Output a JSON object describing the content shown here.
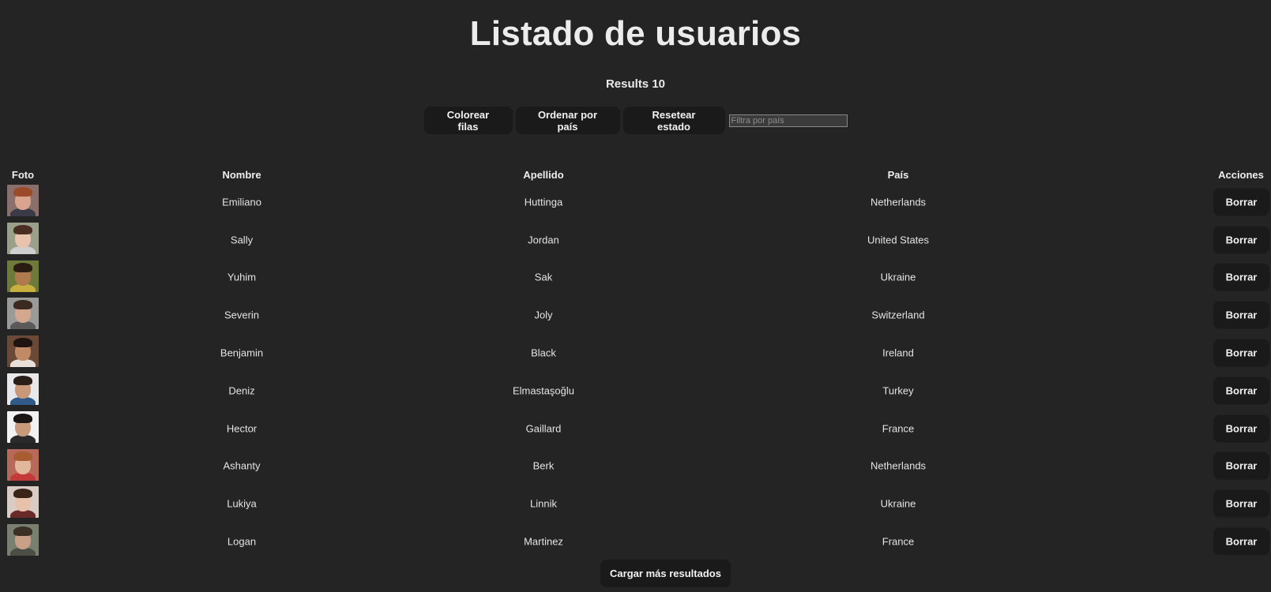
{
  "page": {
    "title": "Listado de usuarios",
    "results_label": "Results 10"
  },
  "controls": {
    "color_rows_label": "Colorear filas",
    "sort_country_label": "Ordenar por país",
    "reset_label": "Resetear estado",
    "filter_placeholder": "Filtra por país",
    "filter_value": ""
  },
  "table": {
    "headers": {
      "photo": "Foto",
      "first_name": "Nombre",
      "last_name": "Apellido",
      "country": "País",
      "actions": "Acciones"
    },
    "delete_label": "Borrar",
    "rows": [
      {
        "first_name": "Emiliano",
        "last_name": "Huttinga",
        "country": "Netherlands",
        "photo": {
          "bg": "#8a6f6a",
          "skin": "#d9a48e",
          "hair": "#9b4a2c",
          "shirt": "#3a3a48"
        }
      },
      {
        "first_name": "Sally",
        "last_name": "Jordan",
        "country": "United States",
        "photo": {
          "bg": "#9aa08a",
          "skin": "#e8c4ae",
          "hair": "#4a2e22",
          "shirt": "#cfcfcf"
        }
      },
      {
        "first_name": "Yuhim",
        "last_name": "Sak",
        "country": "Ukraine",
        "photo": {
          "bg": "#6e7a3a",
          "skin": "#b07a4e",
          "hair": "#2a1c12",
          "shirt": "#c8b040"
        }
      },
      {
        "first_name": "Severin",
        "last_name": "Joly",
        "country": "Switzerland",
        "photo": {
          "bg": "#9a9a98",
          "skin": "#d4a88e",
          "hair": "#3a2a20",
          "shirt": "#5a5a5a"
        }
      },
      {
        "first_name": "Benjamin",
        "last_name": "Black",
        "country": "Ireland",
        "photo": {
          "bg": "#6a4a36",
          "skin": "#c08a66",
          "hair": "#1e1410",
          "shirt": "#e8e0d8"
        }
      },
      {
        "first_name": "Deniz",
        "last_name": "Elmastaşoğlu",
        "country": "Turkey",
        "photo": {
          "bg": "#e8e8ec",
          "skin": "#c89878",
          "hair": "#2a1e18",
          "shirt": "#2f5a8a"
        }
      },
      {
        "first_name": "Hector",
        "last_name": "Gaillard",
        "country": "France",
        "photo": {
          "bg": "#f2f2f2",
          "skin": "#c89a7c",
          "hair": "#1a1412",
          "shirt": "#2a2a2a"
        }
      },
      {
        "first_name": "Ashanty",
        "last_name": "Berk",
        "country": "Netherlands",
        "photo": {
          "bg": "#b86a5a",
          "skin": "#e2b89c",
          "hair": "#a85c30",
          "shirt": "#c43a3a"
        }
      },
      {
        "first_name": "Lukiya",
        "last_name": "Linnik",
        "country": "Ukraine",
        "photo": {
          "bg": "#d8ccc4",
          "skin": "#e6c2aa",
          "hair": "#3a2418",
          "shirt": "#6a2a2a"
        }
      },
      {
        "first_name": "Logan",
        "last_name": "Martinez",
        "country": "France",
        "photo": {
          "bg": "#7a8070",
          "skin": "#c8a088",
          "hair": "#3a3024",
          "shirt": "#4a4e44"
        }
      }
    ]
  },
  "footer": {
    "load_more_label": "Cargar más resultados"
  }
}
